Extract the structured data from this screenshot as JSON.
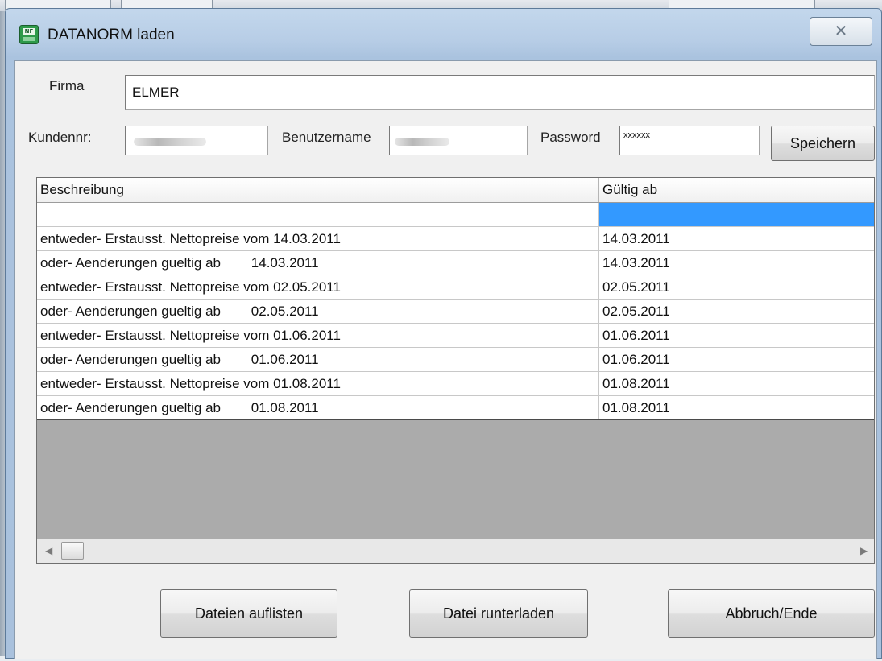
{
  "window": {
    "title": "DATANORM laden",
    "close_glyph": "✕",
    "icon_text": "NF"
  },
  "form": {
    "firma_label": "Firma",
    "firma_value": "ELMER",
    "kundennr_label": "Kundennr:",
    "benutzername_label": "Benutzername",
    "password_label": "Password",
    "password_value": "xxxxxx",
    "save_label": "Speichern"
  },
  "table": {
    "columns": [
      "Beschreibung",
      "Gültig ab"
    ],
    "rows": [
      [
        "",
        ""
      ],
      [
        "entweder- Erstausst. Nettopreise vom 14.03.2011",
        "14.03.2011"
      ],
      [
        "oder- Aenderungen gueltig ab        14.03.2011",
        "14.03.2011"
      ],
      [
        "entweder- Erstausst. Nettopreise vom 02.05.2011",
        "02.05.2011"
      ],
      [
        "oder- Aenderungen gueltig ab        02.05.2011",
        "02.05.2011"
      ],
      [
        "entweder- Erstausst. Nettopreise vom 01.06.2011",
        "01.06.2011"
      ],
      [
        "oder- Aenderungen gueltig ab        01.06.2011",
        "01.06.2011"
      ],
      [
        "entweder- Erstausst. Nettopreise vom 01.08.2011",
        "01.08.2011"
      ],
      [
        "oder- Aenderungen gueltig ab        01.08.2011",
        "01.08.2011"
      ]
    ]
  },
  "scrollbar": {
    "left_arrow": "◀",
    "right_arrow": "▶"
  },
  "buttons": {
    "list_files": "Dateien auflisten",
    "download": "Datei runterladen",
    "cancel": "Abbruch/Ende"
  },
  "colors": {
    "selection": "#3399ff",
    "client_bg": "#f0f0f0"
  }
}
